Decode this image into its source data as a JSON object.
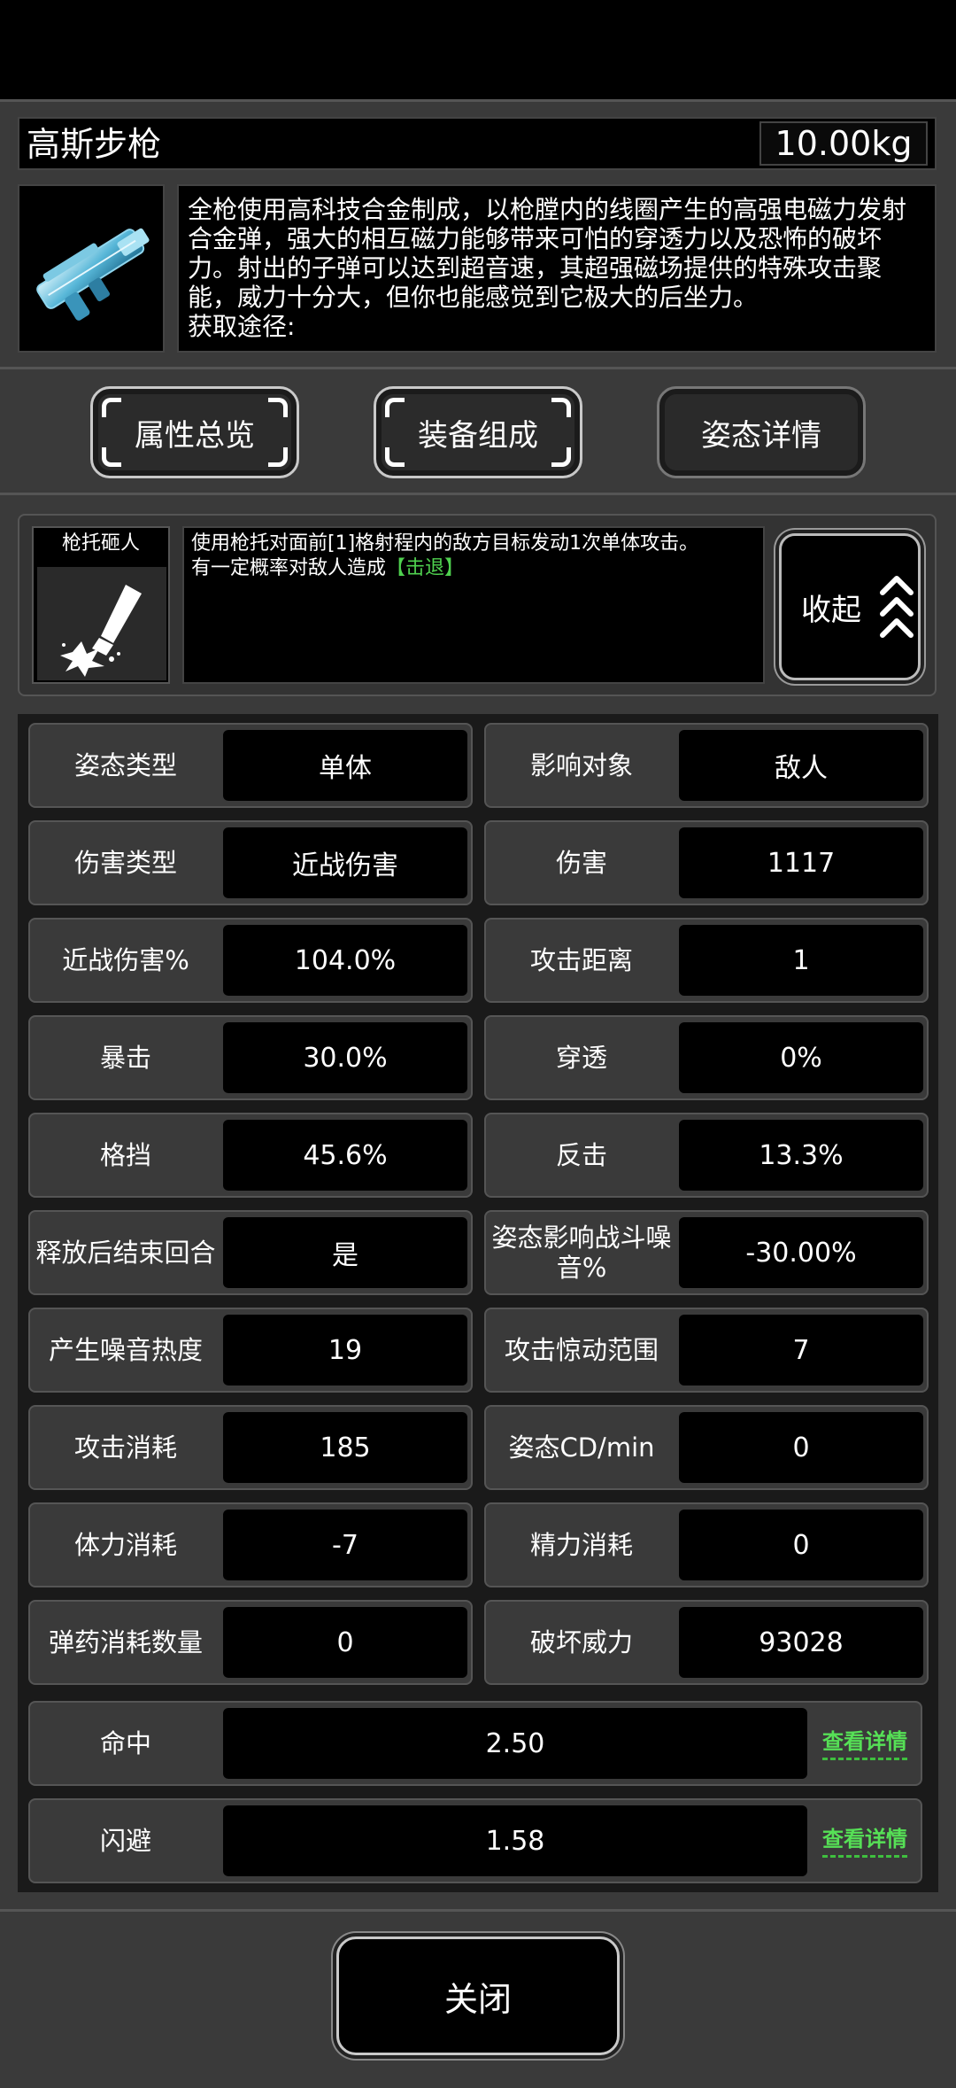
{
  "item": {
    "name": "高斯步枪",
    "weight": "10.00kg",
    "description": "全枪使用高科技合金制成，以枪膛内的线圈产生的高强电磁力发射合金弹，强大的相互磁力能够带来可怕的穿透力以及恐怖的破坏力。射出的子弹可以达到超音速，其超强磁场提供的特殊攻击聚能，威力十分大，但你也能感觉到它极大的后坐力。",
    "source_label": "获取途径:",
    "icon": "gauss-rifle-icon"
  },
  "tabs": [
    {
      "label": "属性总览"
    },
    {
      "label": "装备组成"
    },
    {
      "label": "姿态详情"
    }
  ],
  "skill": {
    "name": "枪托砸人",
    "icon": "smash-icon",
    "desc_line1": "使用枪托对面前[1]格射程内的敌方目标发动1次单体攻击。",
    "desc_line2": "有一定概率对敌人造成",
    "desc_effect": "【击退】",
    "collapse_label": "收起",
    "effect_color": "#4fd14f"
  },
  "stats": [
    {
      "label": "姿态类型",
      "value": "单体"
    },
    {
      "label": "影响对象",
      "value": "敌人"
    },
    {
      "label": "伤害类型",
      "value": "近战伤害"
    },
    {
      "label": "伤害",
      "value": "1117"
    },
    {
      "label": "近战伤害%",
      "value": "104.0%"
    },
    {
      "label": "攻击距离",
      "value": "1"
    },
    {
      "label": "暴击",
      "value": "30.0%"
    },
    {
      "label": "穿透",
      "value": "0%"
    },
    {
      "label": "格挡",
      "value": "45.6%"
    },
    {
      "label": "反击",
      "value": "13.3%"
    },
    {
      "label": "释放后结束回合",
      "value": "是"
    },
    {
      "label": "姿态影响战斗噪音%",
      "value": "-30.00%"
    },
    {
      "label": "产生噪音热度",
      "value": "19"
    },
    {
      "label": "攻击惊动范围",
      "value": "7"
    },
    {
      "label": "攻击消耗",
      "value": "185"
    },
    {
      "label": "姿态CD/min",
      "value": "0"
    },
    {
      "label": "体力消耗",
      "value": "-7"
    },
    {
      "label": "精力消耗",
      "value": "0"
    },
    {
      "label": "弹药消耗数量",
      "value": "0"
    },
    {
      "label": "破坏威力",
      "value": "93028"
    }
  ],
  "wide_stats": [
    {
      "label": "命中",
      "value": "2.50",
      "link": "查看详情"
    },
    {
      "label": "闪避",
      "value": "1.58",
      "link": "查看详情"
    }
  ],
  "close_label": "关闭"
}
